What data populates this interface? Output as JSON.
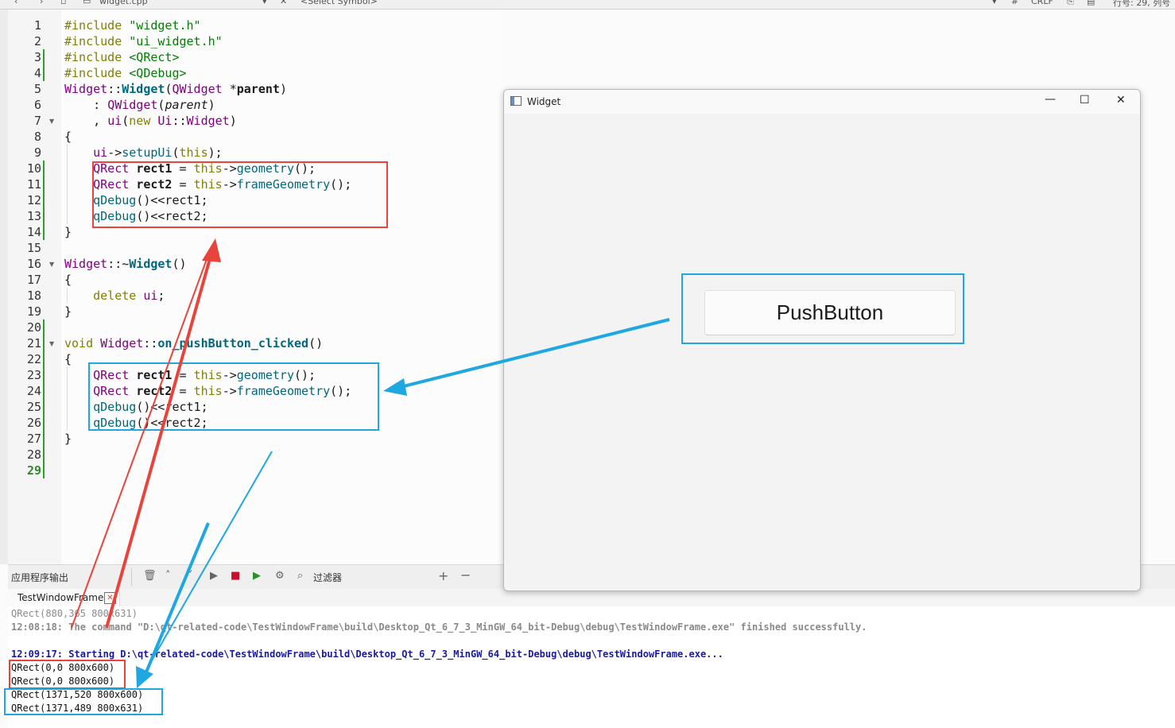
{
  "toolbar": {
    "file_name": "widget.cpp",
    "symbol_placeholder": "<Select Symbol>",
    "hash": "#",
    "line_ending": "CRLF",
    "position": "行号: 29, 列号"
  },
  "editor": {
    "line_numbers": [
      "1",
      "2",
      "3",
      "4",
      "5",
      "6",
      "7",
      "8",
      "9",
      "10",
      "11",
      "12",
      "13",
      "14",
      "15",
      "16",
      "17",
      "18",
      "19",
      "20",
      "21",
      "22",
      "23",
      "24",
      "25",
      "26",
      "27",
      "28",
      "29"
    ]
  },
  "output": {
    "title": "应用程序输出",
    "filter_label": "过滤器",
    "tab_label": "TestWindowFrame",
    "lines": [
      "QRect(880,365 800x631)",
      "12:08:18: The command \"D:\\qt-related-code\\TestWindowFrame\\build\\Desktop_Qt_6_7_3_MinGW_64_bit-Debug\\debug\\TestWindowFrame.exe\" finished successfully.",
      "",
      "12:09:17: Starting D:\\qt-related-code\\TestWindowFrame\\build\\Desktop_Qt_6_7_3_MinGW_64_bit-Debug\\debug\\TestWindowFrame.exe...",
      "QRect(0,0 800x600)",
      "QRect(0,0 800x600)",
      "QRect(1371,520 800x600)",
      "QRect(1371,489 800x631)"
    ]
  },
  "widget_window": {
    "title": "Widget",
    "button_label": "PushButton",
    "minimize": "—",
    "maximize": "☐",
    "close": "✕"
  },
  "colors": {
    "red_annotation": "#e8443c",
    "blue_annotation": "#1ea7e0"
  }
}
